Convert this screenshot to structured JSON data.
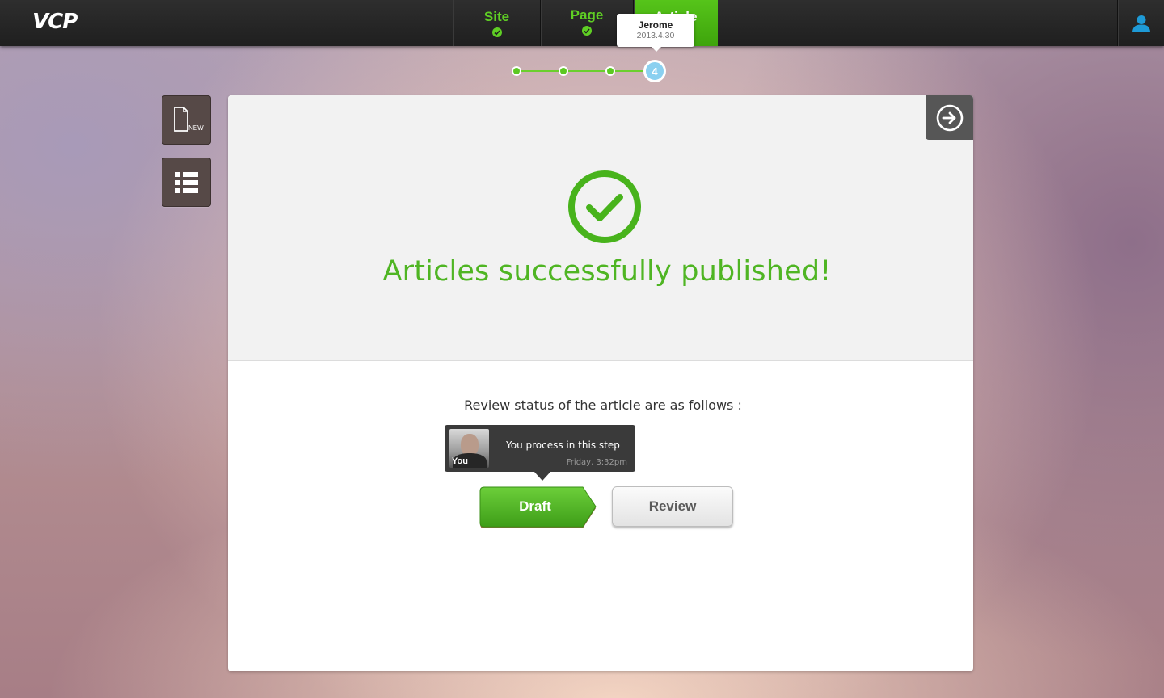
{
  "app": {
    "logo": "VCP"
  },
  "steps": [
    {
      "label": "Site",
      "done": true
    },
    {
      "label": "Page",
      "done": true
    },
    {
      "label": "Article",
      "active": true
    }
  ],
  "author_tooltip": {
    "name": "Jerome",
    "date": "2013.4.30"
  },
  "progress": {
    "current_step": "4",
    "total_dots": 4
  },
  "sidebar": {
    "new_label": "NEW",
    "new_icon": "new-document-icon",
    "list_icon": "list-icon"
  },
  "main": {
    "success_message": "Articles successfully published!",
    "review_title": "Review status of the article are as follows :",
    "process_tooltip": {
      "avatar_label": "You",
      "text": "You process in this step",
      "time": "Friday, 3:32pm"
    },
    "workflow": {
      "draft_label": "Draft",
      "review_label": "Review"
    }
  },
  "colors": {
    "accent_green": "#4fb523",
    "topbar": "#262626",
    "current_step": "#8ad0f0"
  }
}
